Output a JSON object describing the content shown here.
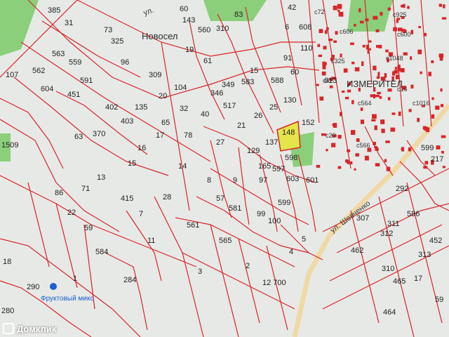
{
  "place_labels": {
    "novoselovka": "Новосел",
    "izmeritel": "ИЗМЕРИТЕЛ",
    "street_top": "ул.",
    "street_shevchenko": "ул. Шевченко",
    "fruit_store": "Фруктовый микс"
  },
  "watermark": {
    "text": "Домклик"
  },
  "colors": {
    "parcel_line": "#d8252b",
    "highlight_parcel": "#e4e54a",
    "green": "#8bcf7a",
    "road": "#f1d9a6",
    "background": "#e7e9e6"
  },
  "parcels": [
    "385",
    "31",
    "73",
    "325",
    "563",
    "559",
    "96",
    "562",
    "604",
    "591",
    "451",
    "402",
    "403",
    "135",
    "1509",
    "63",
    "370",
    "309",
    "20",
    "104",
    "32",
    "40",
    "78",
    "346",
    "349",
    "517",
    "583",
    "15",
    "588",
    "91",
    "60",
    "130",
    "25",
    "26",
    "21",
    "27",
    "137",
    "148",
    "152",
    "129",
    "598",
    "165",
    "597",
    "601",
    "603",
    "57",
    "581",
    "99",
    "100",
    "599",
    "86",
    "22",
    "71",
    "13",
    "415",
    "28",
    "7",
    "11",
    "59",
    "584",
    "565",
    "3",
    "2",
    "4",
    "5",
    "12 700",
    "561",
    "1",
    "284",
    "18",
    "290",
    "280",
    "292",
    "586",
    "307",
    "311",
    "312",
    "313",
    "452",
    "462",
    "310",
    "17",
    "465",
    "464",
    "59",
    "217",
    "599",
    "613",
    "42",
    "608",
    "110",
    "6",
    "60",
    "143",
    "560",
    "310",
    "83",
    "107",
    "19",
    "61",
    "65",
    "17",
    "15",
    "16",
    "14",
    "8",
    "9",
    "97"
  ],
  "small_labels": [
    "c72",
    "c606",
    "c325",
    "c1048",
    "c42",
    "c564",
    "c20",
    "c566",
    "c600",
    "c1016",
    "c925",
    "c16"
  ]
}
